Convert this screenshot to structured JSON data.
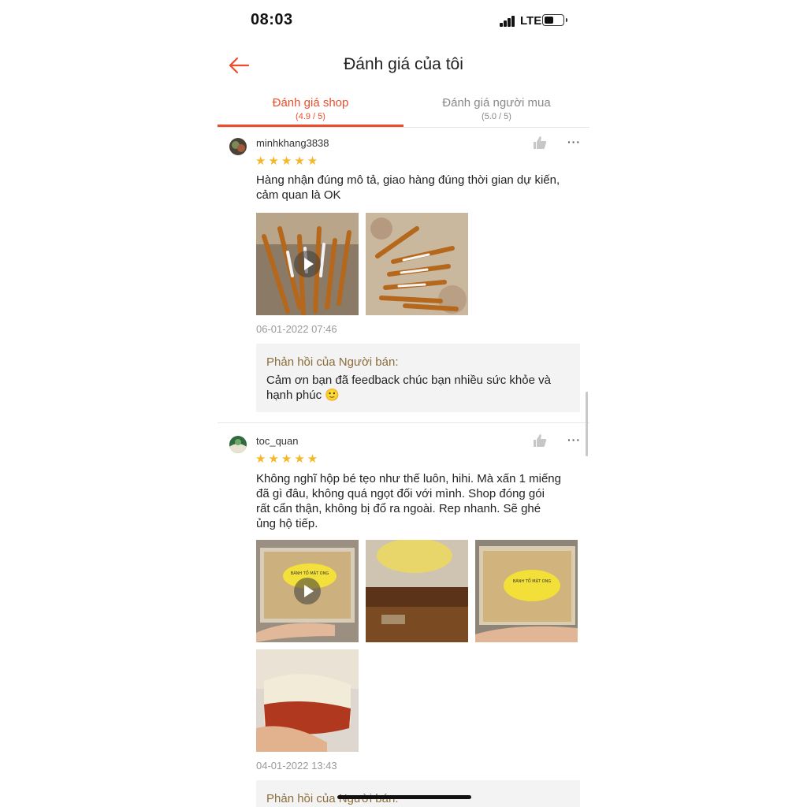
{
  "status_bar": {
    "time": "08:03",
    "network": "LTE",
    "icons": [
      "signal-icon",
      "battery-icon"
    ]
  },
  "header": {
    "title": "Đánh giá của tôi",
    "back_icon": "arrow-left-icon",
    "accent": "#ee4d2d"
  },
  "tabs": [
    {
      "label": "Đánh giá shop",
      "rating": "(4.9 / 5)",
      "active": true
    },
    {
      "label": "Đánh giá người mua",
      "rating": "(5.0 / 5)",
      "active": false
    }
  ],
  "reviews": [
    {
      "username": "minhkhang3838",
      "stars": "★★★★★",
      "rating": 5,
      "text_lines": [
        "Hàng nhận đúng mô tả, giao hàng đúng thời gian dự kiến,",
        "cảm quan là OK"
      ],
      "media": [
        {
          "kind": "video",
          "subject": "honey-sticks"
        },
        {
          "kind": "image",
          "subject": "honey-sticks"
        }
      ],
      "date": "06-01-2022 07:46",
      "reply_title": "Phản hồi của Người bán:",
      "reply_lines": [
        "Cảm ơn bạn đã feedback chúc bạn nhiều sức khỏe và",
        "hạnh phúc 🙂"
      ]
    },
    {
      "username": "toc_quan",
      "stars": "★★★★★",
      "rating": 5,
      "text_lines": [
        "Không nghĩ hộp bé tẹo như thế luôn, hihi. Mà xấn 1 miếng",
        "đã gì đâu, không quá ngọt đối với mình. Shop đóng gói",
        "rất cẩn thận, không bị đổ ra ngoài. Rep nhanh. Sẽ ghé",
        "ủng hộ tiếp."
      ],
      "media": [
        {
          "kind": "video",
          "subject": "honeycomb-box"
        },
        {
          "kind": "image",
          "subject": "honeycomb-box"
        },
        {
          "kind": "image",
          "subject": "honeycomb-box"
        },
        {
          "kind": "image",
          "subject": "honeycomb-piece"
        }
      ],
      "sticker_text": "BÁNH TỔ MẬT ONG",
      "date": "04-01-2022 13:43",
      "reply_title": "Phản hồi của Người bán:"
    }
  ],
  "icons": {
    "like": "thumbs-up-icon",
    "more": "more-options-icon"
  }
}
